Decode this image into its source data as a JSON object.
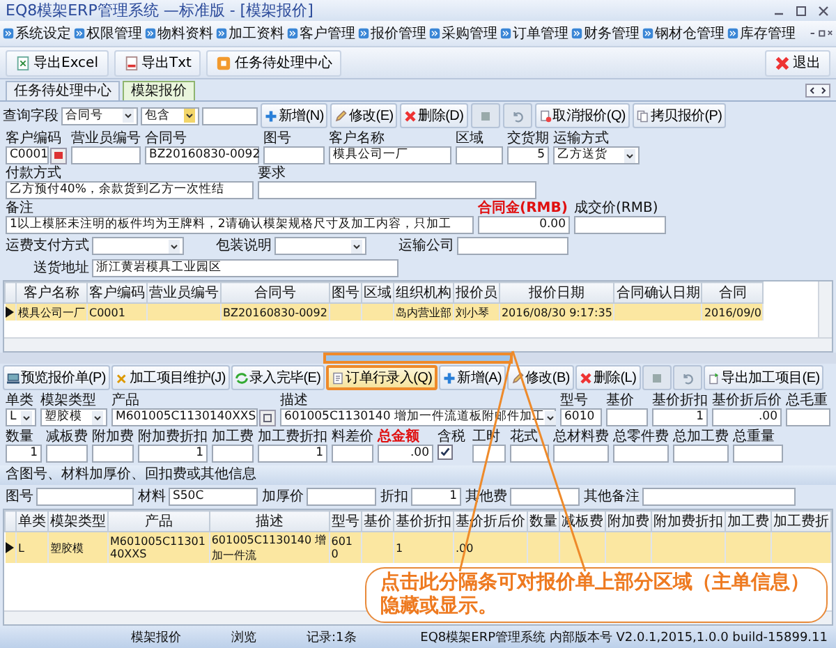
{
  "window": {
    "title": "EQ8模架ERP管理系统 —标准版 - [模架报价]"
  },
  "menu": [
    "系统设定",
    "权限管理",
    "物料资料",
    "加工资料",
    "客户管理",
    "报价管理",
    "采购管理",
    "订单管理",
    "财务管理",
    "钢材仓管理",
    "库存管理"
  ],
  "toolbar": [
    {
      "label": "导出Excel",
      "kind": "excel"
    },
    {
      "label": "导出Txt",
      "kind": "txt"
    },
    {
      "label": "任务待处理中心",
      "kind": "task"
    }
  ],
  "exit_button": "退出",
  "doc_tabs": [
    {
      "label": "任务待处理中心",
      "selected": false
    },
    {
      "label": "模架报价",
      "selected": true
    }
  ],
  "query": {
    "label": "查询字段",
    "field": "合同号",
    "operator": "包含"
  },
  "actions": [
    {
      "label": "新增(N)",
      "kind": "add",
      "disabled": false
    },
    {
      "label": "修改(E)",
      "kind": "edit",
      "disabled": false
    },
    {
      "label": "删除(D)",
      "kind": "delete",
      "disabled": false
    },
    {
      "kind": "save",
      "disabled": true
    },
    {
      "kind": "undo",
      "disabled": true
    },
    {
      "label": "取消报价(Q)",
      "kind": "cancel",
      "disabled": false
    },
    {
      "label": "拷贝报价(P)",
      "kind": "copy",
      "disabled": false
    }
  ],
  "header_form": {
    "rows": [
      {
        "kind": "stacked",
        "fields": [
          {
            "label": "客户编码",
            "value": "C0001",
            "kind": "lookup"
          },
          {
            "label": "营业员编号",
            "kind": "text"
          },
          {
            "label": "合同号",
            "value": "BZ20160830-0092",
            "kind": "text"
          },
          {
            "label": "图号",
            "kind": "text"
          },
          {
            "label": "客户名称",
            "value": "模具公司一厂",
            "kind": "text"
          },
          {
            "label": "区域",
            "kind": "text"
          },
          {
            "label": "交货期",
            "value": "5",
            "kind": "number"
          },
          {
            "label": "运输方式",
            "value": "乙方送货",
            "kind": "select"
          }
        ]
      },
      {
        "kind": "stacked",
        "fields": [
          {
            "label": "付款方式",
            "value": "乙方预付40%，余款货到乙方一次性结",
            "kind": "text"
          },
          {
            "label": "要求",
            "kind": "text"
          }
        ]
      },
      {
        "kind": "stacked",
        "fields": [
          {
            "label": "备注",
            "value": "1以上模胚未注明的板件均为王牌料，2请确认模架规格尺寸及加工内容，只加工",
            "kind": "text",
            "highlight": false
          },
          {
            "label": "合同金(RMB)",
            "value": "0.00",
            "kind": "number",
            "highlight": true
          },
          {
            "label": "成交价(RMB)",
            "kind": "number",
            "highlight": false
          }
        ]
      },
      {
        "kind": "inline",
        "fields": [
          {
            "label": "运费支付方式",
            "kind": "select"
          },
          {
            "label": "包装说明",
            "kind": "select"
          },
          {
            "label": "运输公司",
            "kind": "text"
          }
        ]
      },
      {
        "kind": "inline",
        "fields": [
          {
            "label": "送货地址",
            "value": "浙江黄岩模具工业园区",
            "kind": "text"
          }
        ]
      }
    ]
  },
  "quote_grid": {
    "columns": [
      "客户名称",
      "客户编码",
      "营业员编号",
      "合同号",
      "图号",
      "区域",
      "组织机构",
      "报价员",
      "报价日期",
      "合同确认日期",
      "合同"
    ],
    "rows": [
      {
        "selected": true,
        "cells": [
          "模具公司一厂",
          "C0001",
          null,
          "BZ20160830-0092",
          null,
          null,
          "岛内营业部",
          "刘小琴",
          "2016/08/30 9:17:35",
          null,
          "2016/09/0"
        ]
      }
    ]
  },
  "splitter": {
    "annotated": true
  },
  "line_actions": [
    {
      "label": "预览报价单(P)",
      "kind": "preview",
      "disabled": false,
      "annotated": false
    },
    {
      "label": "加工项目维护(J)",
      "kind": "tools",
      "disabled": false,
      "annotated": false
    },
    {
      "label": "录入完毕(E)",
      "kind": "done",
      "disabled": false,
      "annotated": false
    },
    {
      "label": "订单行录入(Q)",
      "kind": "entry",
      "disabled": false,
      "annotated": true
    },
    {
      "label": "新增(A)",
      "kind": "add",
      "disabled": false,
      "annotated": false
    },
    {
      "label": "修改(B)",
      "kind": "edit",
      "disabled": false,
      "annotated": false
    },
    {
      "label": "删除(L)",
      "kind": "delete",
      "disabled": false,
      "annotated": false
    },
    {
      "kind": "save",
      "disabled": true,
      "annotated": false
    },
    {
      "kind": "undo",
      "disabled": true,
      "annotated": false
    },
    {
      "label": "导出加工项目(E)",
      "kind": "export",
      "disabled": false,
      "annotated": false
    }
  ],
  "line_form": {
    "rows": [
      {
        "kind": "stacked",
        "fields": [
          {
            "label": "单类",
            "value": "L",
            "kind": "select"
          },
          {
            "label": "模架类型",
            "value": "塑胶模",
            "kind": "select"
          },
          {
            "label": "产品",
            "value": "M601005C1130140XXS",
            "kind": "lookup"
          },
          {
            "label": "描述",
            "value": "601005C1130140 增加一件流道板附邮件加工",
            "kind": "select"
          },
          {
            "label": "型号",
            "value": "6010",
            "kind": "text"
          },
          {
            "label": "基价",
            "kind": "number"
          },
          {
            "label": "基价折扣",
            "value": "1",
            "kind": "number"
          },
          {
            "label": "基价折后价",
            "value": ".00",
            "kind": "number"
          },
          {
            "label": "总毛重",
            "kind": "number"
          }
        ]
      },
      {
        "kind": "stacked",
        "fields": [
          {
            "label": "数量",
            "value": "1",
            "kind": "number",
            "highlight": false
          },
          {
            "label": "减板费",
            "kind": "number",
            "highlight": false
          },
          {
            "label": "附加费",
            "kind": "number",
            "highlight": false
          },
          {
            "label": "附加费折扣",
            "value": "1",
            "kind": "number",
            "highlight": false
          },
          {
            "label": "加工费",
            "kind": "number",
            "highlight": false
          },
          {
            "label": "加工费折扣",
            "value": "1",
            "kind": "number",
            "highlight": false
          },
          {
            "label": "料差价",
            "kind": "number",
            "highlight": false
          },
          {
            "label": "总金额",
            "value": ".00",
            "kind": "number",
            "highlight": true
          },
          {
            "label": "含税",
            "kind": "check",
            "checked": true,
            "highlight": false
          },
          {
            "label": "工时",
            "kind": "number",
            "highlight": false
          },
          {
            "label": "花式",
            "kind": "text",
            "highlight": false
          },
          {
            "label": "总材料费",
            "kind": "number",
            "highlight": false
          },
          {
            "label": "总零件费",
            "kind": "number",
            "highlight": false
          },
          {
            "label": "总加工费",
            "kind": "number",
            "highlight": false
          },
          {
            "label": "总重量",
            "kind": "number",
            "highlight": false
          }
        ]
      }
    ]
  },
  "extra_info": {
    "title": "含图号、材料加厚价、回扣费或其他信息",
    "fields": [
      {
        "label": "图号",
        "kind": "text"
      },
      {
        "label": "材料",
        "value": "S50C",
        "kind": "text"
      },
      {
        "label": "加厚价",
        "kind": "number"
      },
      {
        "label": "折扣",
        "value": "1",
        "kind": "number"
      },
      {
        "label": "其他费",
        "kind": "number"
      },
      {
        "label": "其他备注",
        "kind": "text"
      }
    ]
  },
  "line_grid": {
    "columns": [
      "单类",
      "模架类型",
      "产品",
      "描述",
      "型号",
      "基价",
      "基价折扣",
      "基价折后价",
      "数量",
      "减板费",
      "附加费",
      "附加费折扣",
      "加工费",
      "加工费折"
    ],
    "rows": [
      {
        "selected": true,
        "cells": [
          "L",
          "塑胶模",
          "M601005C1130140XXS",
          "601005C1130140 增加一件流",
          "6010",
          null,
          "1",
          ".00",
          null,
          null,
          null,
          null,
          null,
          null
        ]
      }
    ]
  },
  "callout": {
    "text": "点击此分隔条可对报价单上部分区域（主单信息）隐藏或显示。"
  },
  "status_bar": [
    "模架报价",
    "浏览",
    "记录:1条",
    "EQ8模架ERP管理系统 内部版本号 V2.0.1,2015,1.0.0 build-15899.11"
  ]
}
